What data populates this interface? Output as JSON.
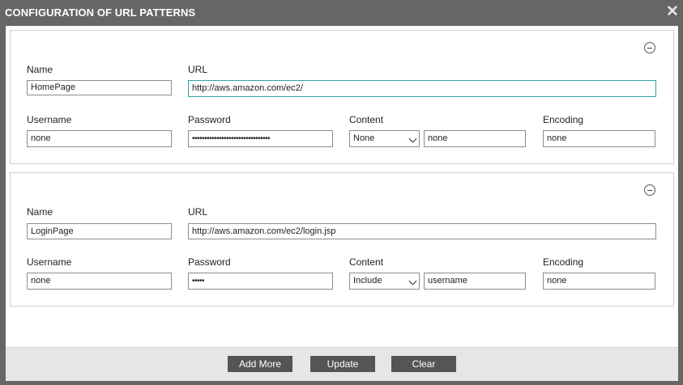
{
  "dialog": {
    "title": "CONFIGURATION OF URL PATTERNS",
    "close_glyph": "✕"
  },
  "patterns": [
    {
      "labels": {
        "name": "Name",
        "url": "URL",
        "username": "Username",
        "password": "Password",
        "content": "Content",
        "encoding": "Encoding"
      },
      "name": "HomePage",
      "url": "http://aws.amazon.com/ec2/",
      "username": "none",
      "password": "••••••••••••••••••••••••••••••••",
      "content_type": "None",
      "content_value": "none",
      "encoding": "none"
    },
    {
      "labels": {
        "name": "Name",
        "url": "URL",
        "username": "Username",
        "password": "Password",
        "content": "Content",
        "encoding": "Encoding"
      },
      "name": "LoginPage",
      "url": "http://aws.amazon.com/ec2/login.jsp",
      "username": "none",
      "password": "•••••",
      "content_type": "Include",
      "content_value": "username",
      "encoding": "none"
    }
  ],
  "footer": {
    "add_more": "Add More",
    "update": "Update",
    "clear": "Clear"
  },
  "icons": {
    "collapse": "minus-circle-icon",
    "close": "close-icon",
    "dropdown": "chevron-down-icon"
  }
}
